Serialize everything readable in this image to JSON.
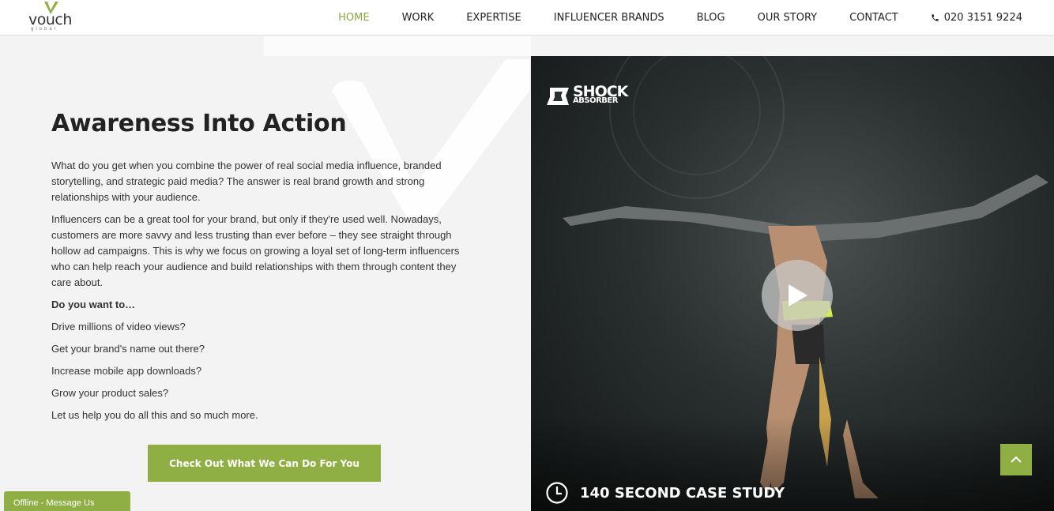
{
  "header": {
    "logo_text": "vouch",
    "logo_sub": "global",
    "nav": [
      {
        "label": "HOME",
        "active": true
      },
      {
        "label": "WORK"
      },
      {
        "label": "EXPERTISE"
      },
      {
        "label": "INFLUENCER BRANDS"
      },
      {
        "label": "BLOG"
      },
      {
        "label": "OUR STORY"
      },
      {
        "label": "CONTACT"
      }
    ],
    "phone": "020 3151 9224",
    "icons": {
      "phone": "phone-icon",
      "logo": "vouch-check-logo"
    }
  },
  "main": {
    "headline": "Awareness Into Action",
    "paragraphs": [
      "What do you get when you combine the power of real social media influence, branded storytelling, and strategic paid media? The answer is real brand growth and strong relationships with your audience.",
      "Influencers can be a great tool for your brand, but only if they're used well. Nowadays, customers are more savvy and less trusting than ever before – they see straight through hollow ad campaigns. This is why we focus on growing a loyal set of long-term influencers who can help reach your audience and build relationships with them through content they care about."
    ],
    "question": "Do you want to…",
    "list": [
      "Drive millions of video views?",
      "Get your brand's name out there?",
      "Increase mobile app downloads?",
      "Grow your product sales?",
      "Let us help you do all this and so much more."
    ],
    "cta_label": "Check Out What We Can Do For You"
  },
  "video": {
    "brand_line1": "SHOCK",
    "brand_line2": "ABSORBER",
    "case_label": "140 SECOND CASE STUDY",
    "icons": {
      "play": "play-icon",
      "clock": "clock-icon"
    }
  },
  "chat": {
    "label": "Offline - Message Us"
  },
  "colors": {
    "accent": "#8fae44",
    "nav_active": "#8aaa42",
    "text": "#333333"
  }
}
